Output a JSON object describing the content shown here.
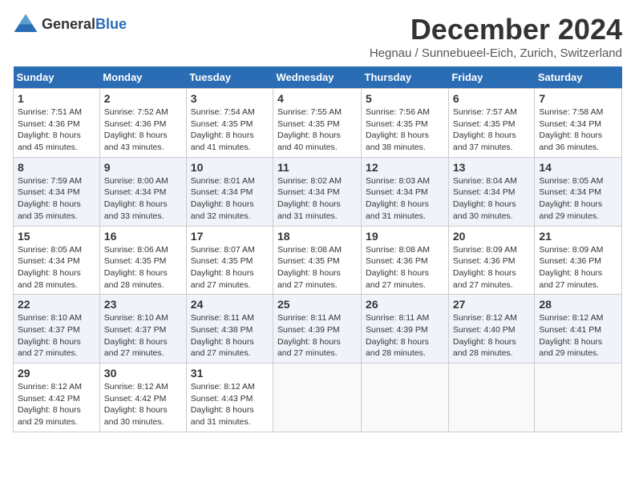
{
  "logo": {
    "text_general": "General",
    "text_blue": "Blue"
  },
  "title": "December 2024",
  "location": "Hegnau / Sunnebueel-Eich, Zurich, Switzerland",
  "weekdays": [
    "Sunday",
    "Monday",
    "Tuesday",
    "Wednesday",
    "Thursday",
    "Friday",
    "Saturday"
  ],
  "weeks": [
    [
      {
        "day": "1",
        "sunrise": "Sunrise: 7:51 AM",
        "sunset": "Sunset: 4:36 PM",
        "daylight": "Daylight: 8 hours and 45 minutes."
      },
      {
        "day": "2",
        "sunrise": "Sunrise: 7:52 AM",
        "sunset": "Sunset: 4:36 PM",
        "daylight": "Daylight: 8 hours and 43 minutes."
      },
      {
        "day": "3",
        "sunrise": "Sunrise: 7:54 AM",
        "sunset": "Sunset: 4:35 PM",
        "daylight": "Daylight: 8 hours and 41 minutes."
      },
      {
        "day": "4",
        "sunrise": "Sunrise: 7:55 AM",
        "sunset": "Sunset: 4:35 PM",
        "daylight": "Daylight: 8 hours and 40 minutes."
      },
      {
        "day": "5",
        "sunrise": "Sunrise: 7:56 AM",
        "sunset": "Sunset: 4:35 PM",
        "daylight": "Daylight: 8 hours and 38 minutes."
      },
      {
        "day": "6",
        "sunrise": "Sunrise: 7:57 AM",
        "sunset": "Sunset: 4:35 PM",
        "daylight": "Daylight: 8 hours and 37 minutes."
      },
      {
        "day": "7",
        "sunrise": "Sunrise: 7:58 AM",
        "sunset": "Sunset: 4:34 PM",
        "daylight": "Daylight: 8 hours and 36 minutes."
      }
    ],
    [
      {
        "day": "8",
        "sunrise": "Sunrise: 7:59 AM",
        "sunset": "Sunset: 4:34 PM",
        "daylight": "Daylight: 8 hours and 35 minutes."
      },
      {
        "day": "9",
        "sunrise": "Sunrise: 8:00 AM",
        "sunset": "Sunset: 4:34 PM",
        "daylight": "Daylight: 8 hours and 33 minutes."
      },
      {
        "day": "10",
        "sunrise": "Sunrise: 8:01 AM",
        "sunset": "Sunset: 4:34 PM",
        "daylight": "Daylight: 8 hours and 32 minutes."
      },
      {
        "day": "11",
        "sunrise": "Sunrise: 8:02 AM",
        "sunset": "Sunset: 4:34 PM",
        "daylight": "Daylight: 8 hours and 31 minutes."
      },
      {
        "day": "12",
        "sunrise": "Sunrise: 8:03 AM",
        "sunset": "Sunset: 4:34 PM",
        "daylight": "Daylight: 8 hours and 31 minutes."
      },
      {
        "day": "13",
        "sunrise": "Sunrise: 8:04 AM",
        "sunset": "Sunset: 4:34 PM",
        "daylight": "Daylight: 8 hours and 30 minutes."
      },
      {
        "day": "14",
        "sunrise": "Sunrise: 8:05 AM",
        "sunset": "Sunset: 4:34 PM",
        "daylight": "Daylight: 8 hours and 29 minutes."
      }
    ],
    [
      {
        "day": "15",
        "sunrise": "Sunrise: 8:05 AM",
        "sunset": "Sunset: 4:34 PM",
        "daylight": "Daylight: 8 hours and 28 minutes."
      },
      {
        "day": "16",
        "sunrise": "Sunrise: 8:06 AM",
        "sunset": "Sunset: 4:35 PM",
        "daylight": "Daylight: 8 hours and 28 minutes."
      },
      {
        "day": "17",
        "sunrise": "Sunrise: 8:07 AM",
        "sunset": "Sunset: 4:35 PM",
        "daylight": "Daylight: 8 hours and 27 minutes."
      },
      {
        "day": "18",
        "sunrise": "Sunrise: 8:08 AM",
        "sunset": "Sunset: 4:35 PM",
        "daylight": "Daylight: 8 hours and 27 minutes."
      },
      {
        "day": "19",
        "sunrise": "Sunrise: 8:08 AM",
        "sunset": "Sunset: 4:36 PM",
        "daylight": "Daylight: 8 hours and 27 minutes."
      },
      {
        "day": "20",
        "sunrise": "Sunrise: 8:09 AM",
        "sunset": "Sunset: 4:36 PM",
        "daylight": "Daylight: 8 hours and 27 minutes."
      },
      {
        "day": "21",
        "sunrise": "Sunrise: 8:09 AM",
        "sunset": "Sunset: 4:36 PM",
        "daylight": "Daylight: 8 hours and 27 minutes."
      }
    ],
    [
      {
        "day": "22",
        "sunrise": "Sunrise: 8:10 AM",
        "sunset": "Sunset: 4:37 PM",
        "daylight": "Daylight: 8 hours and 27 minutes."
      },
      {
        "day": "23",
        "sunrise": "Sunrise: 8:10 AM",
        "sunset": "Sunset: 4:37 PM",
        "daylight": "Daylight: 8 hours and 27 minutes."
      },
      {
        "day": "24",
        "sunrise": "Sunrise: 8:11 AM",
        "sunset": "Sunset: 4:38 PM",
        "daylight": "Daylight: 8 hours and 27 minutes."
      },
      {
        "day": "25",
        "sunrise": "Sunrise: 8:11 AM",
        "sunset": "Sunset: 4:39 PM",
        "daylight": "Daylight: 8 hours and 27 minutes."
      },
      {
        "day": "26",
        "sunrise": "Sunrise: 8:11 AM",
        "sunset": "Sunset: 4:39 PM",
        "daylight": "Daylight: 8 hours and 28 minutes."
      },
      {
        "day": "27",
        "sunrise": "Sunrise: 8:12 AM",
        "sunset": "Sunset: 4:40 PM",
        "daylight": "Daylight: 8 hours and 28 minutes."
      },
      {
        "day": "28",
        "sunrise": "Sunrise: 8:12 AM",
        "sunset": "Sunset: 4:41 PM",
        "daylight": "Daylight: 8 hours and 29 minutes."
      }
    ],
    [
      {
        "day": "29",
        "sunrise": "Sunrise: 8:12 AM",
        "sunset": "Sunset: 4:42 PM",
        "daylight": "Daylight: 8 hours and 29 minutes."
      },
      {
        "day": "30",
        "sunrise": "Sunrise: 8:12 AM",
        "sunset": "Sunset: 4:42 PM",
        "daylight": "Daylight: 8 hours and 30 minutes."
      },
      {
        "day": "31",
        "sunrise": "Sunrise: 8:12 AM",
        "sunset": "Sunset: 4:43 PM",
        "daylight": "Daylight: 8 hours and 31 minutes."
      },
      null,
      null,
      null,
      null
    ]
  ]
}
